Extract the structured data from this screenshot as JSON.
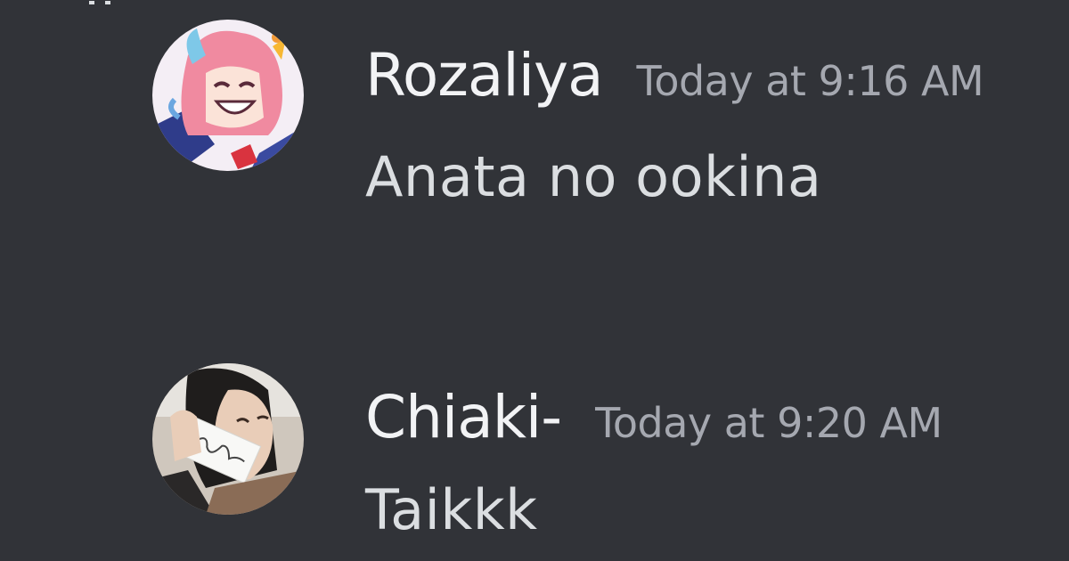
{
  "colors": {
    "background": "#313338",
    "username": "#f2f3f5",
    "timestamp": "#a5a8b0",
    "message_text": "#dbdee1"
  },
  "messages": [
    {
      "username": "Rozaliya",
      "timestamp": "Today at 9:16 AM",
      "text": "Anata no ookina",
      "avatar_icon": "anime-girl-avatar"
    },
    {
      "username": "Chiaki-",
      "timestamp": "Today at 9:20 AM",
      "text": "Taikkk",
      "avatar_icon": "photo-avatar"
    }
  ]
}
